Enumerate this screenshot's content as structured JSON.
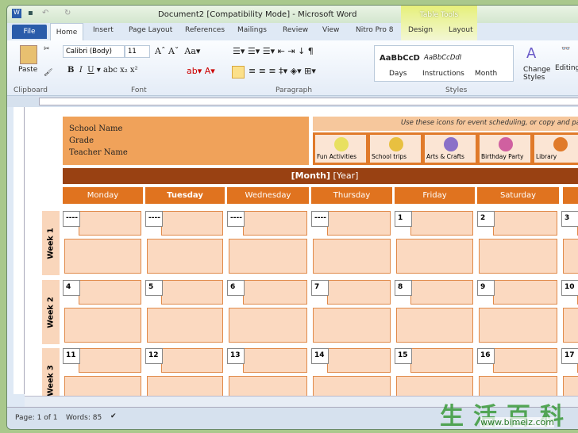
{
  "window": {
    "title": "Document2 [Compatibility Mode] - Microsoft Word",
    "contextual_tab": "Table Tools"
  },
  "tabs": [
    "File",
    "Home",
    "Insert",
    "Page Layout",
    "References",
    "Mailings",
    "Review",
    "View",
    "Nitro Pro 8",
    "Design",
    "Layout"
  ],
  "ribbon": {
    "clipboard": {
      "label": "Clipboard",
      "paste": "Paste"
    },
    "font": {
      "label": "Font",
      "font_name": "Calibri (Body)",
      "font_size": "11"
    },
    "paragraph": {
      "label": "Paragraph"
    },
    "styles": {
      "label": "Styles",
      "items": [
        {
          "preview": "AaBbCcD",
          "name": "Days"
        },
        {
          "preview": "AaBbCcDdI",
          "name": "Instructions"
        },
        {
          "preview": "",
          "name": "Month"
        }
      ],
      "change_styles": "Change Styles"
    },
    "editing": {
      "label": "Editing"
    }
  },
  "document": {
    "school_lines": [
      "School Name",
      "Grade",
      "Teacher Name"
    ],
    "instructions": "Use these icons for event scheduling, or copy and paste",
    "icons": [
      {
        "label": "Fun Activities",
        "color": "#e8e060"
      },
      {
        "label": "School trips",
        "color": "#e8c040"
      },
      {
        "label": "Arts & Crafts",
        "color": "#8a70c8"
      },
      {
        "label": "Birthday Party",
        "color": "#d060a0"
      },
      {
        "label": "Library",
        "color": "#e07a2a"
      }
    ],
    "month": "[Month]",
    "year": "[Year]",
    "days": [
      "Monday",
      "Tuesday",
      "Wednesday",
      "Thursday",
      "Friday",
      "Saturday"
    ],
    "weeks": [
      {
        "label": "Week 1",
        "dates": [
          "----",
          "----",
          "----",
          "----",
          "1",
          "2",
          "3"
        ]
      },
      {
        "label": "Week 2",
        "dates": [
          "4",
          "5",
          "6",
          "7",
          "8",
          "9",
          "10"
        ]
      },
      {
        "label": "Week 3",
        "dates": [
          "11",
          "12",
          "13",
          "14",
          "15",
          "16",
          "17"
        ]
      }
    ]
  },
  "status": {
    "page": "Page: 1 of 1",
    "words": "Words: 85"
  },
  "watermark": {
    "text": "生活百科",
    "url": "www.bimeiz.com"
  },
  "colors": {
    "accent": "#e0731f",
    "month_bar": "#994112",
    "cell": "#fbd9c0"
  }
}
